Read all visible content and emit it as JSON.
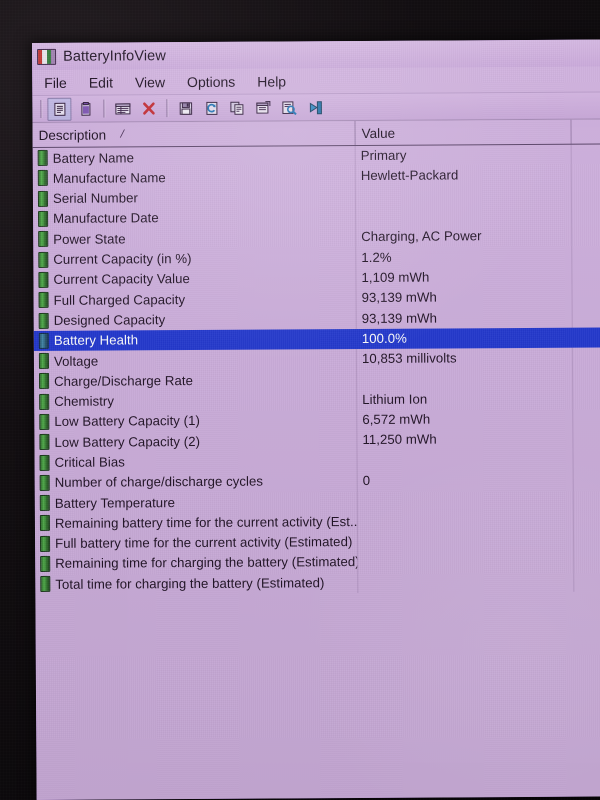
{
  "window": {
    "title": "BatteryInfoView",
    "app_icon": "battery-icon"
  },
  "menu": {
    "items": [
      {
        "label": "File",
        "name": "menu-file"
      },
      {
        "label": "Edit",
        "name": "menu-edit"
      },
      {
        "label": "View",
        "name": "menu-view"
      },
      {
        "label": "Options",
        "name": "menu-options"
      },
      {
        "label": "Help",
        "name": "menu-help"
      }
    ]
  },
  "toolbar": {
    "buttons": [
      {
        "icon": "battery-information-icon",
        "pressed": true
      },
      {
        "icon": "battery-log-icon",
        "pressed": false
      },
      {
        "icon": "html-report-icon",
        "pressed": false
      },
      {
        "icon": "delete-red-x-icon",
        "pressed": false
      },
      {
        "icon": "save-floppy-icon",
        "pressed": false
      },
      {
        "icon": "refresh-icon",
        "pressed": false
      },
      {
        "icon": "copy-icon",
        "pressed": false
      },
      {
        "icon": "properties-icon",
        "pressed": false
      },
      {
        "icon": "find-icon",
        "pressed": false
      },
      {
        "icon": "exit-icon",
        "pressed": false
      }
    ]
  },
  "list": {
    "columns": [
      {
        "label": "Description",
        "name": "column-description"
      },
      {
        "label": "Value",
        "name": "column-value"
      }
    ],
    "sort_indicator": "/",
    "selected_index": 9,
    "rows": [
      {
        "description": "Battery Name",
        "value": "Primary"
      },
      {
        "description": "Manufacture Name",
        "value": "Hewlett-Packard"
      },
      {
        "description": "Serial Number",
        "value": ""
      },
      {
        "description": "Manufacture Date",
        "value": ""
      },
      {
        "description": "Power State",
        "value": "Charging, AC Power"
      },
      {
        "description": "Current Capacity (in %)",
        "value": "1.2%"
      },
      {
        "description": "Current Capacity Value",
        "value": "1,109 mWh"
      },
      {
        "description": "Full Charged Capacity",
        "value": "93,139 mWh"
      },
      {
        "description": "Designed Capacity",
        "value": "93,139 mWh"
      },
      {
        "description": "Battery Health",
        "value": "100.0%"
      },
      {
        "description": "Voltage",
        "value": "10,853 millivolts"
      },
      {
        "description": "Charge/Discharge Rate",
        "value": ""
      },
      {
        "description": "Chemistry",
        "value": "Lithium Ion"
      },
      {
        "description": "Low Battery Capacity (1)",
        "value": "6,572 mWh"
      },
      {
        "description": "Low Battery Capacity (2)",
        "value": "11,250 mWh"
      },
      {
        "description": "Critical Bias",
        "value": ""
      },
      {
        "description": "Number of charge/discharge cycles",
        "value": "0"
      },
      {
        "description": "Battery Temperature",
        "value": ""
      },
      {
        "description": "Remaining battery time for the current activity (Est...",
        "value": ""
      },
      {
        "description": "Full battery time for the current activity (Estimated)",
        "value": ""
      },
      {
        "description": "Remaining time for charging the battery (Estimated)",
        "value": ""
      },
      {
        "description": "Total  time for charging the battery (Estimated)",
        "value": ""
      }
    ]
  },
  "colors": {
    "window_background": "#cdaedd",
    "selection_blue": "#1f35cf",
    "selection_text": "#ffffff",
    "text": "#1d0f22",
    "battery_green": "#4fae49",
    "bezel": "#0d0a0c"
  }
}
